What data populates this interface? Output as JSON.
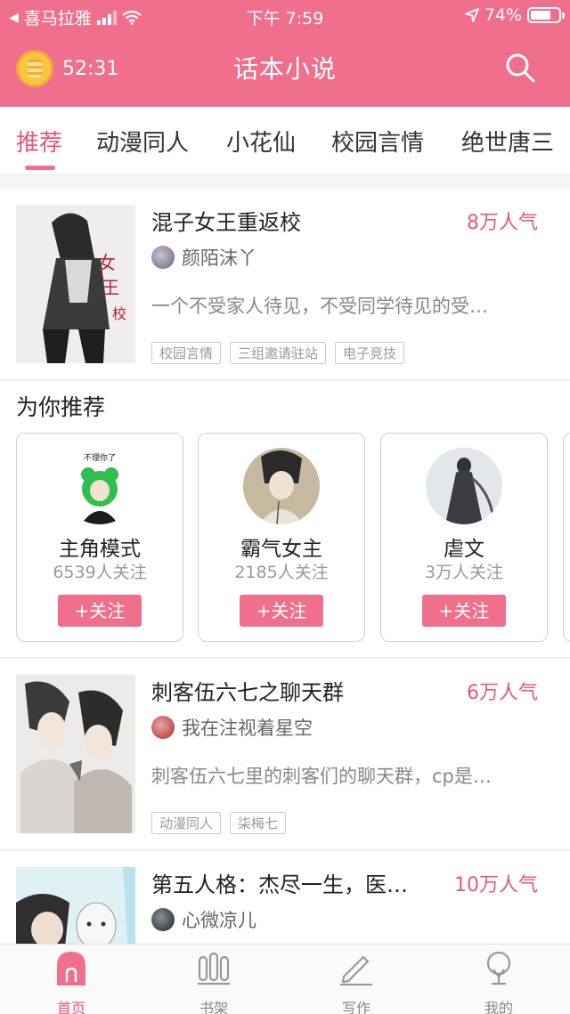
{
  "status_bar": {
    "carrier": "喜马拉雅",
    "time": "下午 7:59",
    "battery": "74%",
    "battery_level": 0.74
  },
  "header": {
    "timer": "52:31",
    "title": "话本小说"
  },
  "tabs": [
    {
      "label": "推荐",
      "active": true
    },
    {
      "label": "动漫同人"
    },
    {
      "label": "小花仙"
    },
    {
      "label": "校园言情"
    },
    {
      "label": "绝世唐三"
    }
  ],
  "books": [
    {
      "title": "混子女王重返校",
      "popularity": "8万人气",
      "author": "颜陌沫丫",
      "description": "一个不受家人待见，不受同学待见的受…",
      "tags": [
        "校园言情",
        "三组邀请驻站",
        "电子竞技"
      ]
    },
    {
      "title": "刺客伍六七之聊天群",
      "popularity": "6万人气",
      "author": "我在注视着星空",
      "description": "刺客伍六七里的刺客们的聊天群，cp是…",
      "tags": [
        "动漫同人",
        "柒梅七"
      ]
    },
    {
      "title": "第五人格：杰尽一生，医…",
      "popularity": "10万人气",
      "author": "心微凉儿",
      "description": "",
      "tags": []
    }
  ],
  "recommend": {
    "title": "为你推荐",
    "cards": [
      {
        "name": "主角模式",
        "followers": "6539人关注",
        "button": "+关注",
        "pic_caption": "不理你了"
      },
      {
        "name": "霸气女主",
        "followers": "2185人关注",
        "button": "+关注"
      },
      {
        "name": "虐文",
        "followers": "3万人关注",
        "button": "+关注"
      }
    ]
  },
  "bottom_nav": [
    {
      "label": "首页",
      "icon": "home-icon",
      "active": true
    },
    {
      "label": "书架",
      "icon": "bookshelf-icon"
    },
    {
      "label": "写作",
      "icon": "pen-icon"
    },
    {
      "label": "我的",
      "icon": "profile-icon"
    }
  ],
  "colors": {
    "brand_pink": "#ef6f8d",
    "accent_text": "#e8577a"
  }
}
